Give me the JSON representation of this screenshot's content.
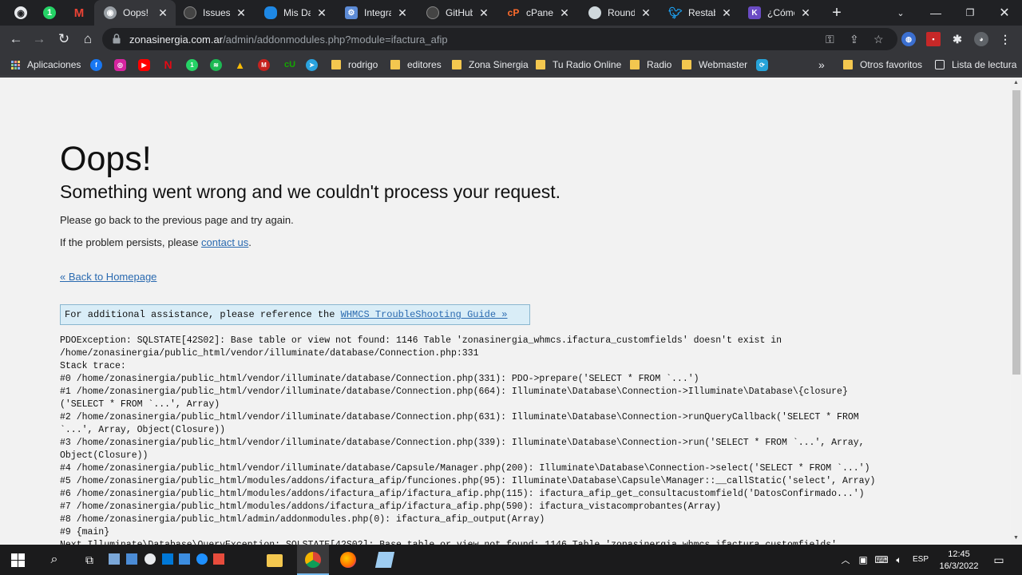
{
  "tabs": [
    {
      "title": "Oops!",
      "active": true,
      "icon": "chrome-default-icon"
    },
    {
      "title": "Issues · ",
      "icon": "github-icon"
    },
    {
      "title": "Mis Datos",
      "icon": "cloud-icon"
    },
    {
      "title": "Integrar",
      "icon": "openai-icon"
    },
    {
      "title": "GitHub",
      "icon": "github-icon"
    },
    {
      "title": "cPanel",
      "icon": "cpanel-icon"
    },
    {
      "title": "Roundcube",
      "icon": "roundcube-icon"
    },
    {
      "title": "Restable",
      "icon": "twitter-icon"
    },
    {
      "title": "¿Cómo",
      "icon": "k-icon"
    }
  ],
  "url": {
    "host": "zonasinergia.com.ar",
    "path": "/admin/addonmodules.php?module=ifactura_afip"
  },
  "bookmarks": {
    "apps_label": "Aplicaciones",
    "folders": [
      "rodrigo",
      "editores",
      "Zona Sinergia",
      "Tu Radio Online",
      "Radio",
      "Webmaster"
    ],
    "other_favorites": "Otros favoritos",
    "reading_list": "Lista de lectura",
    "overflow": "»"
  },
  "page": {
    "title": "Oops!",
    "subtitle": "Something went wrong and we couldn't process your request.",
    "line1": "Please go back to the previous page and try again.",
    "line2_prefix": "If the problem persists, please ",
    "contact_link": "contact us",
    "line2_suffix": ".",
    "back_link": "« Back to Homepage",
    "assist_prefix": "For additional assistance, please reference the ",
    "assist_link": "WHMCS TroubleShooting Guide »",
    "trace": "PDOException: SQLSTATE[42S02]: Base table or view not found: 1146 Table 'zonasinergia_whmcs.ifactura_customfields' doesn't exist in\n/home/zonasinergia/public_html/vendor/illuminate/database/Connection.php:331\nStack trace:\n#0 /home/zonasinergia/public_html/vendor/illuminate/database/Connection.php(331): PDO->prepare('SELECT * FROM `...')\n#1 /home/zonasinergia/public_html/vendor/illuminate/database/Connection.php(664): Illuminate\\Database\\Connection->Illuminate\\Database\\{closure}\n('SELECT * FROM `...', Array)\n#2 /home/zonasinergia/public_html/vendor/illuminate/database/Connection.php(631): Illuminate\\Database\\Connection->runQueryCallback('SELECT * FROM\n`...', Array, Object(Closure))\n#3 /home/zonasinergia/public_html/vendor/illuminate/database/Connection.php(339): Illuminate\\Database\\Connection->run('SELECT * FROM `...', Array,\nObject(Closure))\n#4 /home/zonasinergia/public_html/vendor/illuminate/database/Capsule/Manager.php(200): Illuminate\\Database\\Connection->select('SELECT * FROM `...')\n#5 /home/zonasinergia/public_html/modules/addons/ifactura_afip/funciones.php(95): Illuminate\\Database\\Capsule\\Manager::__callStatic('select', Array)\n#6 /home/zonasinergia/public_html/modules/addons/ifactura_afip/ifactura_afip.php(115): ifactura_afip_get_consultacustomfield('DatosConfirmado...')\n#7 /home/zonasinergia/public_html/modules/addons/ifactura_afip/ifactura_afip.php(590): ifactura_vistacomprobantes(Array)\n#8 /home/zonasinergia/public_html/admin/addonmodules.php(0): ifactura_afip_output(Array)\n#9 {main}\nNext Illuminate\\Database\\QueryException: SQLSTATE[42S02]: Base table or view not found: 1146 Table 'zonasinergia_whmcs.ifactura_customfields'"
  },
  "taskbar": {
    "lang": "ESP",
    "time": "12:45",
    "date": "16/3/2022"
  },
  "colors": {
    "chrome_dark": "#202124",
    "toolbar": "#35363a",
    "link": "#2a6ab0",
    "assist_bg": "#d9edf7"
  }
}
